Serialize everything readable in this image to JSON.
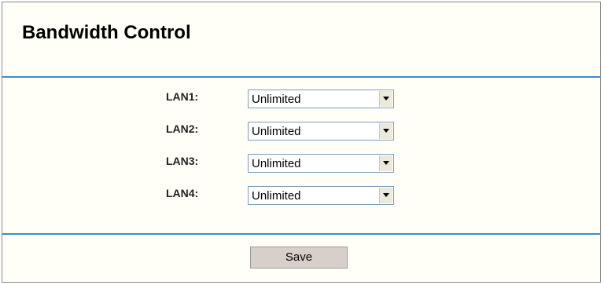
{
  "page": {
    "title": "Bandwidth Control"
  },
  "lan_rows": [
    {
      "label": "LAN1:",
      "value": "Unlimited"
    },
    {
      "label": "LAN2:",
      "value": "Unlimited"
    },
    {
      "label": "LAN3:",
      "value": "Unlimited"
    },
    {
      "label": "LAN4:",
      "value": "Unlimited"
    }
  ],
  "actions": {
    "save_label": "Save"
  },
  "colors": {
    "accent_rule": "#3d8dc9",
    "panel_bg": "#fffff7",
    "button_bg": "#d8d0c8"
  }
}
